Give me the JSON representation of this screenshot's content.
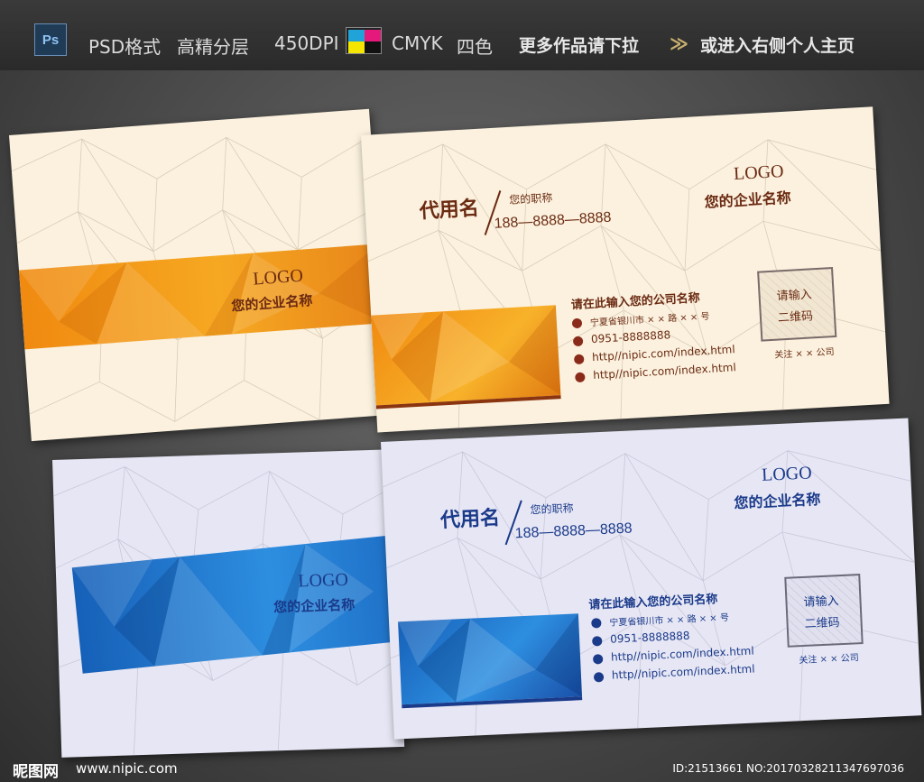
{
  "topbar": {
    "ps_label": "Ps",
    "format": "PSD格式",
    "quality": "高精分层",
    "dpi": "450DPI",
    "color_mode": "CMYK",
    "four_color": "四色",
    "more": "更多作品请下拉",
    "personal": "或进入右侧个人主页",
    "chevron": "≫"
  },
  "orange_back": {
    "logo": "LOGO",
    "company": "您的企业名称"
  },
  "orange_front": {
    "name": "代用名",
    "title": "您的职称",
    "phone": "188—8888—8888",
    "logo": "LOGO",
    "company": "您的企业名称",
    "company_input": "请在此输入您的公司名称",
    "address": "宁夏省银川市 × × 路 × × 号",
    "tel": "0951-8888888",
    "web1": "http//nipic.com/index.html",
    "web2": "http//nipic.com/index.html",
    "qr_line1": "请输入",
    "qr_line2": "二维码",
    "follow": "关注 × × 公司"
  },
  "blue_back": {
    "logo": "LOGO",
    "company": "您的企业名称"
  },
  "blue_front": {
    "name": "代用名",
    "title": "您的职称",
    "phone": "188—8888—8888",
    "logo": "LOGO",
    "company": "您的企业名称",
    "company_input": "请在此输入您的公司名称",
    "address": "宁夏省银川市 × × 路 × × 号",
    "tel": "0951-8888888",
    "web1": "http//nipic.com/index.html",
    "web2": "http//nipic.com/index.html",
    "qr_line1": "请输入",
    "qr_line2": "二维码",
    "follow": "关注 × × 公司"
  },
  "footer": {
    "site": "昵图网",
    "url": "www.nipic.com",
    "id": "ID:21513661 NO:20170328211347697036"
  },
  "colors": {
    "orange_accent": "#f29a12",
    "orange_text": "#6b2a12",
    "blue_accent": "#1e6fc6",
    "blue_text": "#1a3a8a",
    "cream": "#fbf1de",
    "lavender": "#e6e6f4"
  }
}
